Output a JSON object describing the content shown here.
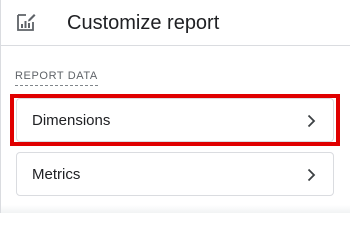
{
  "header": {
    "title": "Customize report",
    "icon": "report-chart-edit-icon"
  },
  "section": {
    "label": "REPORT DATA"
  },
  "items": [
    {
      "label": "Dimensions",
      "icon": "chevron-right-icon",
      "highlighted": true
    },
    {
      "label": "Metrics",
      "icon": "chevron-right-icon",
      "highlighted": false
    }
  ],
  "colors": {
    "highlight": "#e00000",
    "border": "#dadce0",
    "text": "#202124",
    "muted": "#5f6368"
  }
}
